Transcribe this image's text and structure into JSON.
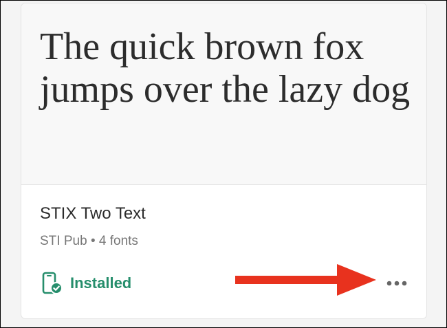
{
  "card": {
    "preview_text": "The quick brown fox jumps over the lazy dog",
    "font_name": "STIX Two Text",
    "foundry": "STI Pub",
    "separator": "•",
    "font_count": "4 fonts",
    "status_label": "Installed",
    "status_icon": "device-installed-icon",
    "more_icon": "more-dots-icon"
  },
  "annotation": {
    "arrow_color": "#e8321e",
    "arrow_icon": "red-arrow-icon"
  },
  "colors": {
    "installed_green": "#268e6c",
    "title_text": "#2c2c2c",
    "meta_text": "#777777",
    "more_dots": "#666666"
  }
}
